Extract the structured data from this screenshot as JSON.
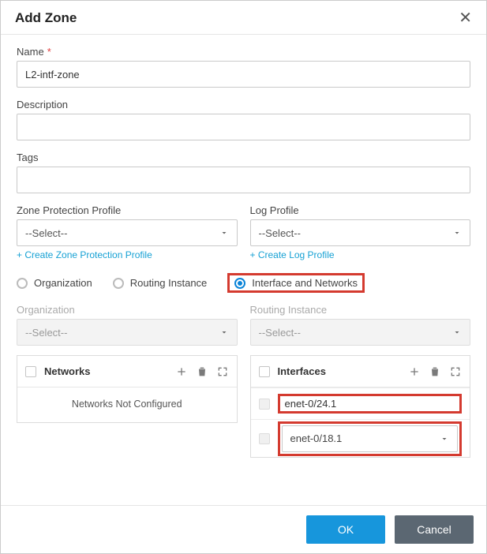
{
  "dialog": {
    "title": "Add Zone"
  },
  "fields": {
    "name": {
      "label": "Name",
      "value": "L2-intf-zone",
      "required": true
    },
    "description": {
      "label": "Description",
      "value": ""
    },
    "tags": {
      "label": "Tags",
      "value": ""
    },
    "zone_protection": {
      "label": "Zone Protection Profile",
      "selected": "--Select--",
      "create_link": "+ Create Zone Protection Profile"
    },
    "log_profile": {
      "label": "Log Profile",
      "selected": "--Select--",
      "create_link": "+ Create Log Profile"
    }
  },
  "scope": {
    "options": [
      "Organization",
      "Routing Instance",
      "Interface and Networks"
    ],
    "selected": "Interface and Networks",
    "organization": {
      "label": "Organization",
      "selected": "--Select--",
      "disabled": true
    },
    "routing_instance": {
      "label": "Routing Instance",
      "selected": "--Select--",
      "disabled": true
    }
  },
  "networks": {
    "header": "Networks",
    "empty_text": "Networks Not Configured",
    "rows": []
  },
  "interfaces": {
    "header": "Interfaces",
    "rows": [
      {
        "value": "enet-0/24.1",
        "type": "text"
      },
      {
        "value": "enet-0/18.1",
        "type": "select"
      }
    ]
  },
  "footer": {
    "ok": "OK",
    "cancel": "Cancel"
  }
}
